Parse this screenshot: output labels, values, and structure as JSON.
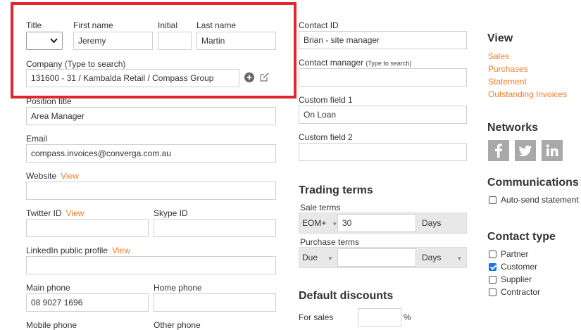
{
  "left": {
    "title_label": "Title",
    "first_name_label": "First name",
    "first_name_value": "Jeremy",
    "initial_label": "Initial",
    "initial_value": "",
    "last_name_label": "Last name",
    "last_name_value": "Martin",
    "company_label": "Company (Type to search)",
    "company_value": "131600 - 31 / Kambalda Retail / Compass Group",
    "position_label": "Position title",
    "position_value": "Area Manager",
    "email_label": "Email",
    "email_value": "compass.invoices@converga.com.au",
    "website_label": "Website",
    "website_view": "View",
    "website_value": "",
    "twitter_label": "Twitter ID",
    "twitter_view": "View",
    "twitter_value": "",
    "skype_label": "Skype ID",
    "skype_value": "",
    "linkedin_label": "LinkedIn public profile",
    "linkedin_view": "View",
    "linkedin_value": "",
    "main_phone_label": "Main phone",
    "main_phone_value": "08 9027 1696",
    "home_phone_label": "Home phone",
    "home_phone_value": "",
    "mobile_phone_label": "Mobile phone",
    "other_phone_label": "Other phone"
  },
  "middle": {
    "contact_id_label": "Contact ID",
    "contact_id_value": "Brian - site manager",
    "contact_manager_label": "Contact manager",
    "contact_manager_hint": "(Type to search)",
    "contact_manager_value": "",
    "custom1_label": "Custom field 1",
    "custom1_value": "On Loan",
    "custom2_label": "Custom field 2",
    "custom2_value": "",
    "trading_terms_title": "Trading terms",
    "sale_terms_label": "Sale terms",
    "sale_terms_option": "EOM+",
    "sale_terms_value": "30",
    "sale_terms_unit": "Days",
    "purchase_terms_label": "Purchase terms",
    "purchase_terms_option": "Due",
    "purchase_terms_value": "",
    "purchase_terms_unit": "Days",
    "default_discounts_title": "Default discounts",
    "for_sales_label": "For sales",
    "for_sales_value": "",
    "percent": "%"
  },
  "right": {
    "view_title": "View",
    "view_links": [
      "Sales",
      "Purchases",
      "Statement",
      "Outstanding Invoices"
    ],
    "networks_title": "Networks",
    "network_icons": [
      "facebook-icon",
      "twitter-icon",
      "linkedin-icon"
    ],
    "communications_title": "Communications",
    "auto_send_label": "Auto-send statement",
    "contact_type_title": "Contact type",
    "contact_types": [
      {
        "label": "Partner",
        "checked": false
      },
      {
        "label": "Customer",
        "checked": true
      },
      {
        "label": "Supplier",
        "checked": false
      },
      {
        "label": "Contractor",
        "checked": false
      }
    ]
  }
}
